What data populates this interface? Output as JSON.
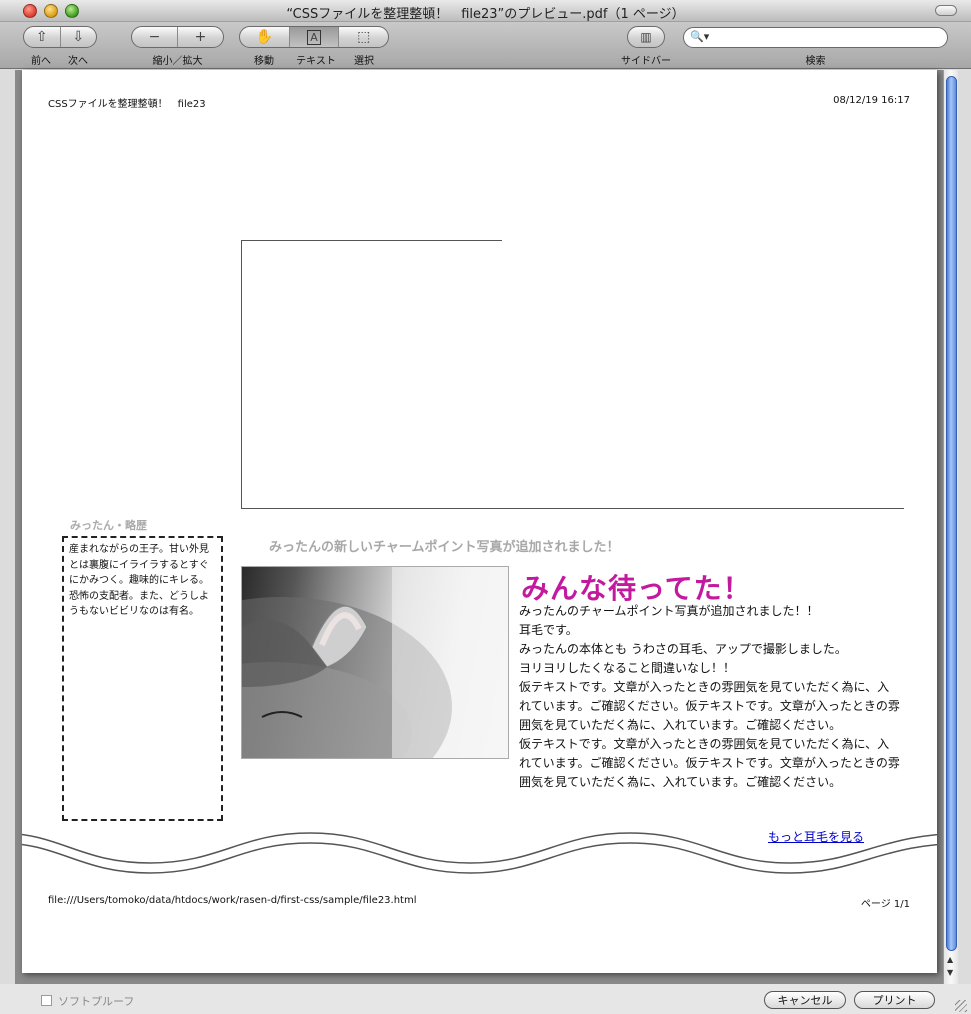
{
  "window": {
    "title": "“CSSファイルを整理整頓！　file23”のプレビュー.pdf（1 ページ）"
  },
  "toolbar": {
    "prev_label": "前へ",
    "next_label": "次へ",
    "zoom_label": "縮小／拡大",
    "move_label": "移動",
    "text_label": "テキスト",
    "select_label": "選択",
    "sidebar_label": "サイドバー",
    "search_label": "検索",
    "search_value": ""
  },
  "page": {
    "header_title": "CSSファイルを整理整頓！　file23",
    "header_date": "08/12/19 16:17",
    "side_heading": "みったん・略歴",
    "side_text": "産まれながらの王子。甘い外見とは裏腹にイライラするとすぐにかみつく。趣味的にキレる。恐怖の支配者。また、どうしようもないビビリなのは有名。",
    "sub_heading": "みったんの新しいチャームポイント写真が追加されました！",
    "main_heading": "みんな待ってた！",
    "body_lines": [
      "みったんのチャームポイント写真が追加されました！！",
      "耳毛です。",
      "みったんの本体とも うわさの耳毛、アップで撮影しました。",
      "ヨリヨリしたくなること間違いなし！！",
      "仮テキストです。文章が入ったときの雰囲気を見ていただく為に、入れています。ご確認ください。仮テキストです。文章が入ったときの雰囲気を見ていただく為に、入れています。ご確認ください。",
      "仮テキストです。文章が入ったときの雰囲気を見ていただく為に、入れています。ご確認ください。仮テキストです。文章が入ったときの雰囲気を見ていただく為に、入れています。ご確認ください。"
    ],
    "more_link": "もっと耳毛を見る",
    "footer_path": "file:///Users/tomoko/data/htdocs/work/rasen-d/first-css/sample/file23.html",
    "footer_page": "ページ 1/1"
  },
  "bottom": {
    "softproof_label": "ソフトプルーフ",
    "cancel_label": "キャンセル",
    "print_label": "プリント"
  },
  "colors": {
    "heading_accent": "#c3199f",
    "link": "#0000cc",
    "scroll_thumb": "#4a7bd8"
  }
}
